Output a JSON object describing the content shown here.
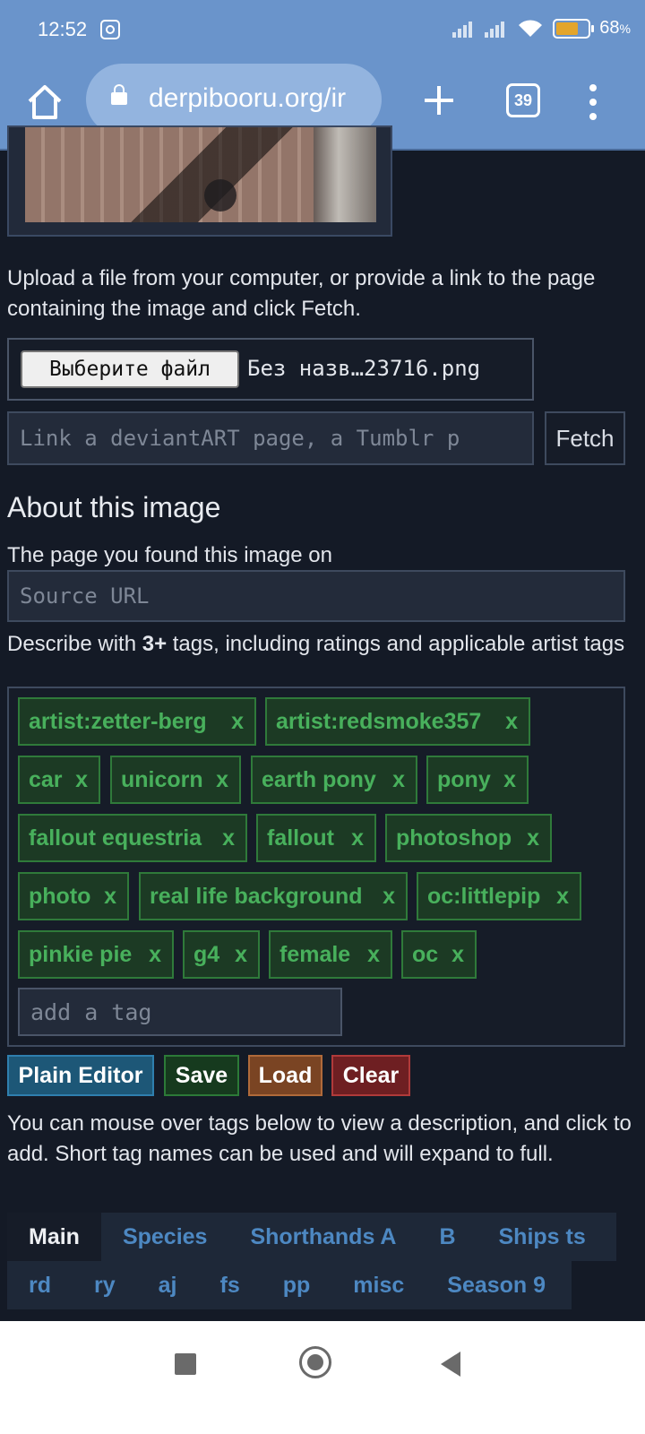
{
  "status_bar": {
    "time": "12:52",
    "battery": "68",
    "battery_unit": "%"
  },
  "browser": {
    "url": "derpibooru.org/ir",
    "tab_count": "39"
  },
  "upload": {
    "instructions": "Upload a file from your computer, or provide a link to the page containing the image and click Fetch.",
    "file_button": "Выберите файл",
    "file_name": "Без назв…23716.png",
    "link_placeholder": "Link a deviantART page, a Tumblr p",
    "fetch_label": "Fetch"
  },
  "about": {
    "title": "About this image",
    "source_label": "The page you found this image on",
    "source_placeholder": "Source URL",
    "describe_prefix": "Describe with ",
    "describe_bold": "3+",
    "describe_suffix": " tags, including ratings and applicable artist tags"
  },
  "tags": {
    "items": [
      "artist:zetter-berg",
      "artist:redsmoke357",
      "car",
      "unicorn",
      "earth pony",
      "pony",
      "fallout equestria",
      "fallout",
      "photoshop",
      "photo",
      "real life background",
      "oc:littlepip",
      "pinkie pie",
      "g4",
      "female",
      "oc"
    ],
    "remove_label": "x",
    "input_placeholder": "add a tag"
  },
  "actions": {
    "plain_editor": "Plain Editor",
    "save": "Save",
    "load": "Load",
    "clear": "Clear"
  },
  "hint": "You can mouse over tags below to view a description, and click to add. Short tag names can be used and will expand to full.",
  "tag_tabs": {
    "row1": [
      "Main",
      "Species",
      "Shorthands A",
      "B",
      "Ships ts"
    ],
    "row2": [
      "rd",
      "ry",
      "aj",
      "fs",
      "pp",
      "misc",
      "Season 9"
    ]
  },
  "colors": {
    "accent_blue": "#6a94cb",
    "tag_green": "#48b05c",
    "background": "#141a26"
  }
}
